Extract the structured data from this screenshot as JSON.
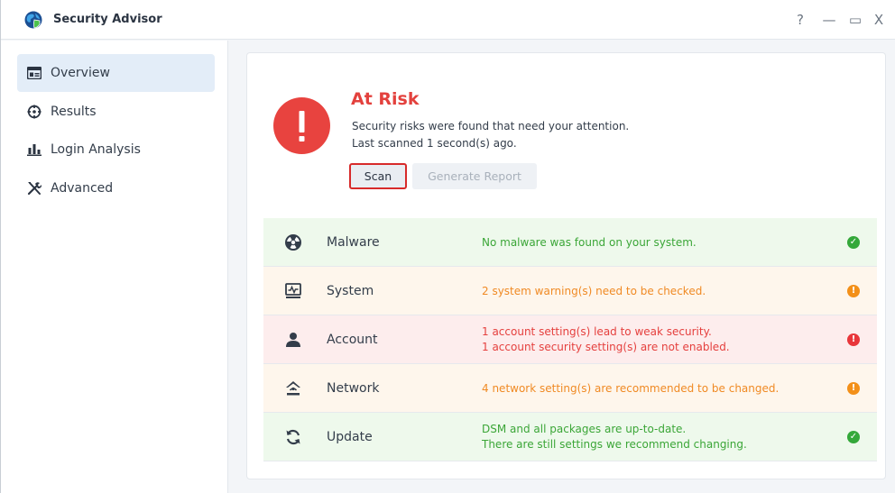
{
  "window": {
    "title": "Security Advisor",
    "controls": {
      "help": "?",
      "minimize": "—",
      "maximize": "▭",
      "close": "X"
    }
  },
  "sidebar": {
    "items": [
      {
        "label": "Overview",
        "icon": "overview-icon",
        "active": true
      },
      {
        "label": "Results",
        "icon": "results-icon",
        "active": false
      },
      {
        "label": "Login Analysis",
        "icon": "login-analysis-icon",
        "active": false
      },
      {
        "label": "Advanced",
        "icon": "advanced-tools-icon",
        "active": false
      }
    ]
  },
  "status": {
    "icon_glyph": "!",
    "title": "At Risk",
    "description": "Security risks were found that need your attention.",
    "last_scanned": "Last scanned 1 second(s) ago.",
    "scan_button": "Scan",
    "report_button": "Generate Report"
  },
  "categories": [
    {
      "name": "Malware",
      "icon": "malware-icon",
      "level": "ok",
      "lines": [
        "No malware was found on your system."
      ]
    },
    {
      "name": "System",
      "icon": "system-monitor-icon",
      "level": "warning",
      "lines": [
        "2 system warning(s) need to be checked."
      ]
    },
    {
      "name": "Account",
      "icon": "account-icon",
      "level": "danger",
      "lines": [
        "1 account setting(s) lead to weak security.",
        "1 account security setting(s) are not enabled."
      ]
    },
    {
      "name": "Network",
      "icon": "network-icon",
      "level": "warning",
      "lines": [
        "4 network setting(s) are recommended to be changed."
      ]
    },
    {
      "name": "Update",
      "icon": "update-icon",
      "level": "ok",
      "lines": [
        "DSM and all packages are up-to-date.",
        "There are still settings we recommend changing."
      ]
    }
  ],
  "colors": {
    "ok_bg": "#eef9ec",
    "ok_text": "#3ba637",
    "ok_badge": "#34a83a",
    "warning_bg": "#fef6ec",
    "warning_text": "#f08a24",
    "warning_badge": "#f39019",
    "danger_bg": "#fdeded",
    "danger_text": "#e5403e",
    "danger_badge": "#e8363a",
    "at_risk": "#e8433f",
    "scan_highlight": "#d72a2a"
  },
  "status_glyphs": {
    "ok": "✓",
    "warning": "!",
    "danger": "!"
  }
}
